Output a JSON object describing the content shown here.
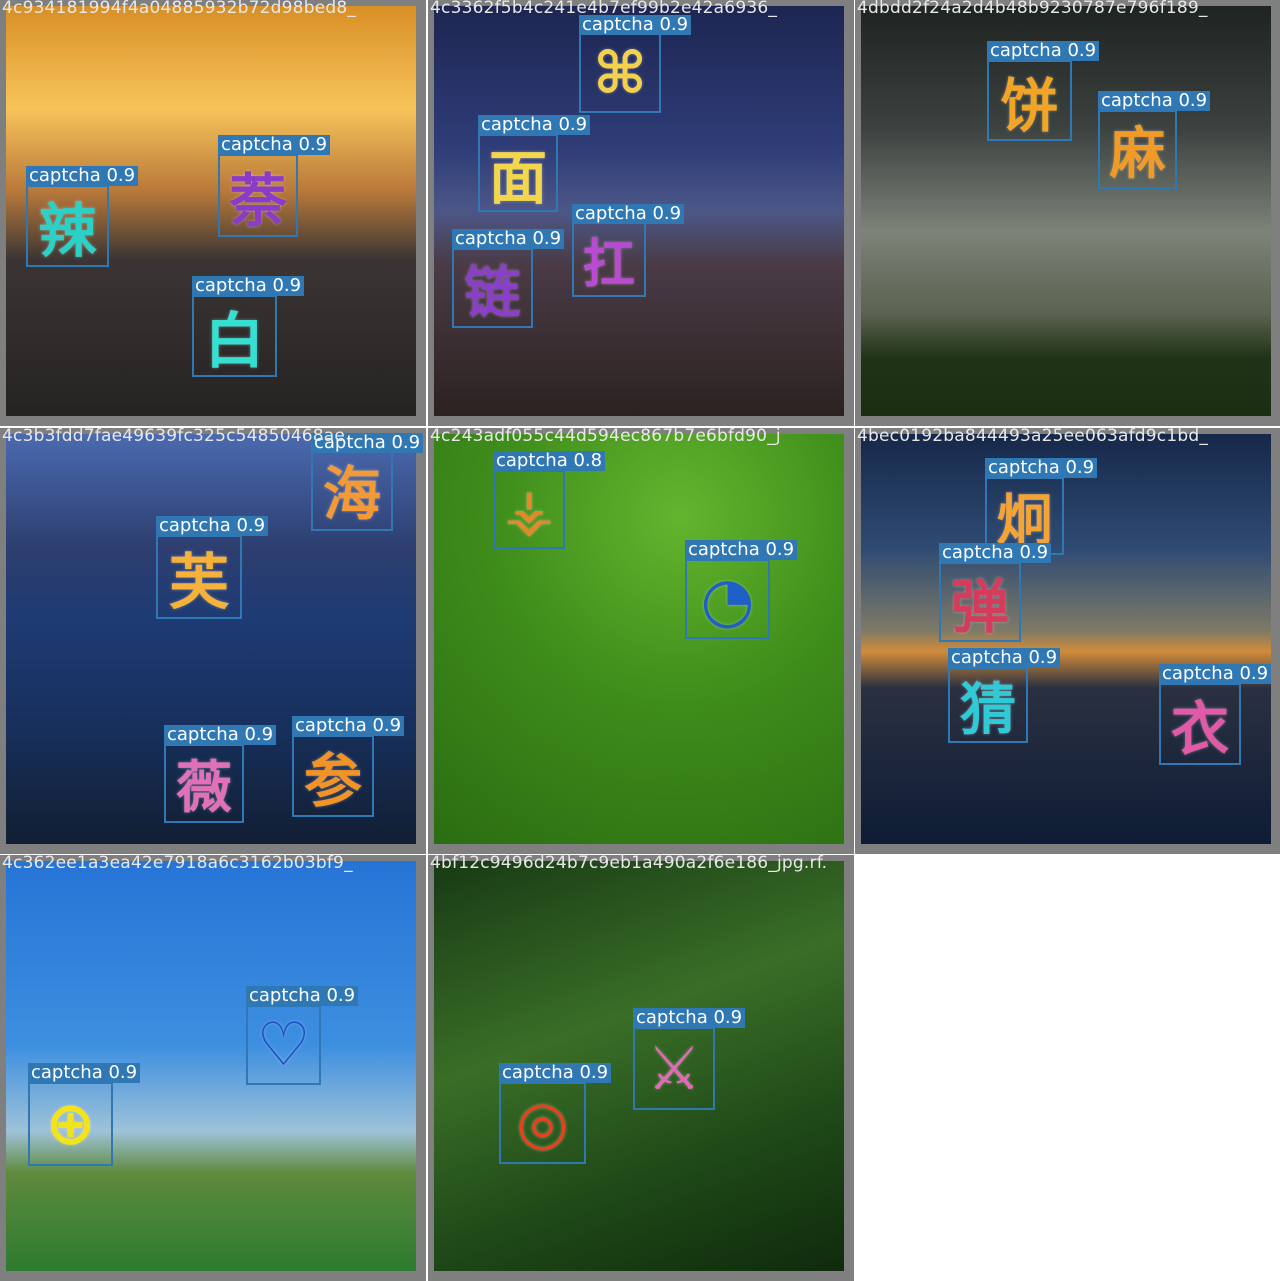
{
  "label_text": "captcha",
  "tiles": [
    {
      "filename": "4c934181994f4a04885932b72d98bed8_",
      "detections": [
        {
          "label": "captcha 0.9",
          "char": "辣",
          "color": "#2bd0c7"
        },
        {
          "label": "captcha 0.9",
          "char": "萘",
          "color": "#8a3cc9"
        },
        {
          "label": "captcha 0.9",
          "char": "白",
          "color": "#35e0d2"
        }
      ]
    },
    {
      "filename": "4c3362f5b4c241e4b7ef99b2e42a6936_",
      "detections": [
        {
          "label": "captcha 0.9",
          "char": "⌘",
          "color": "#f4d14a"
        },
        {
          "label": "captcha 0.9",
          "char": "面",
          "color": "#f3d64b"
        },
        {
          "label": "captcha 0.9",
          "char": "扛",
          "color": "#b84bd0"
        },
        {
          "label": "captcha 0.9",
          "char": "链",
          "color": "#8a3fc8"
        }
      ]
    },
    {
      "filename": "4dbdd2f24a2d4b48b9230787e796f189_",
      "detections": [
        {
          "label": "captcha 0.9",
          "char": "饼",
          "color": "#f2a424"
        },
        {
          "label": "captcha 0.9",
          "char": "麻",
          "color": "#f29a26"
        }
      ]
    },
    {
      "filename": "4c3b3fdd7fae49639fc325c54850468ae",
      "detections": [
        {
          "label": "captcha 0.9",
          "char": "海",
          "color": "#f39a36"
        },
        {
          "label": "captcha 0.9",
          "char": "芙",
          "color": "#f5b13a"
        },
        {
          "label": "captcha 0.9",
          "char": "薇",
          "color": "#e071b8"
        },
        {
          "label": "captcha 0.9",
          "char": "参",
          "color": "#f19326"
        }
      ]
    },
    {
      "filename": "4c243adf055c44d594ec867b7e6bfd90_j",
      "detections": [
        {
          "label": "captcha 0.8",
          "char": "⚶",
          "color": "#e3892a"
        },
        {
          "label": "captcha 0.9",
          "char": "◔",
          "color": "#1f5fc8"
        }
      ]
    },
    {
      "filename": "4bec0192ba844493a25ee063afd9c1bd_",
      "detections": [
        {
          "label": "captcha 0.9",
          "char": "炯",
          "color": "#f4a337"
        },
        {
          "label": "captcha 0.9",
          "char": "弹",
          "color": "#d53c5c"
        },
        {
          "label": "captcha 0.9",
          "char": "猜",
          "color": "#30c9d6"
        },
        {
          "label": "captcha 0.9",
          "char": "衣",
          "color": "#e05aa8"
        }
      ]
    },
    {
      "filename": "4c362ee1a3ea42e7918a6c3162b03bf9_",
      "detections": [
        {
          "label": "captcha 0.9",
          "char": "♡",
          "color": "#1f4cc9"
        },
        {
          "label": "captcha 0.9",
          "char": "⊕",
          "color": "#f5e31a"
        }
      ]
    },
    {
      "filename": "4bf12c9496d24b7c9eb1a490a2f6e186_jpg.rf.",
      "detections": [
        {
          "label": "captcha 0.9",
          "char": "⚔",
          "color": "#e06ab6"
        },
        {
          "label": "captcha 0.9",
          "char": "◎",
          "color": "#e8401d"
        }
      ]
    }
  ]
}
